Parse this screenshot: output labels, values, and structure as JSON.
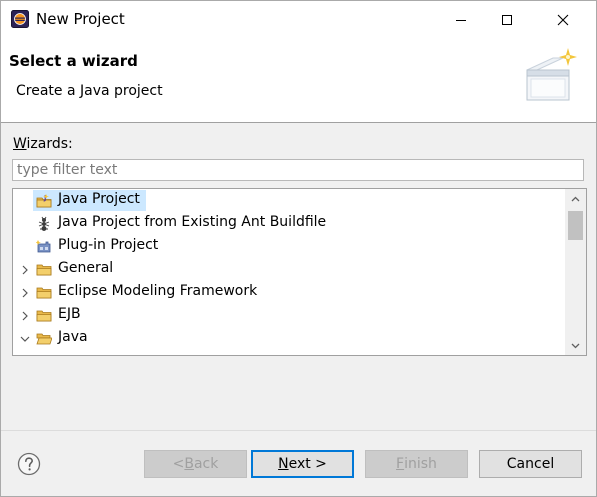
{
  "window": {
    "title": "New Project"
  },
  "banner": {
    "title": "Select a wizard",
    "description": "Create a Java project"
  },
  "wizards": {
    "label_mnemonic": "W",
    "label_rest": "izards:",
    "filter_placeholder": "type filter text",
    "filter_value": "",
    "items": [
      {
        "label": "Java Project",
        "icon": "java-project-icon",
        "expandable": false,
        "selected": true
      },
      {
        "label": "Java Project from Existing Ant Buildfile",
        "icon": "ant-icon",
        "expandable": false,
        "selected": false
      },
      {
        "label": "Plug-in Project",
        "icon": "plugin-icon",
        "expandable": false,
        "selected": false
      },
      {
        "label": "General",
        "icon": "folder-icon",
        "expandable": true,
        "expanded": false
      },
      {
        "label": "Eclipse Modeling Framework",
        "icon": "folder-icon",
        "expandable": true,
        "expanded": false
      },
      {
        "label": "EJB",
        "icon": "folder-icon",
        "expandable": true,
        "expanded": false
      },
      {
        "label": "Java",
        "icon": "folder-icon",
        "expandable": true,
        "expanded": true
      }
    ]
  },
  "buttons": {
    "back_prefix": "< ",
    "back_mnemonic": "B",
    "back_rest": "ack",
    "next_mnemonic": "N",
    "next_rest": "ext >",
    "finish_mnemonic": "F",
    "finish_rest": "inish",
    "cancel": "Cancel"
  },
  "colors": {
    "selection": "#cce8ff",
    "folder": "#e8b84a",
    "default_button_border": "#0078d7"
  }
}
